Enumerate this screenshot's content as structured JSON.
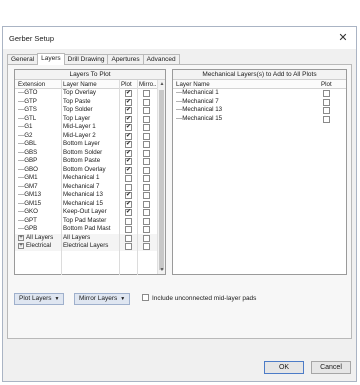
{
  "window": {
    "title": "Gerber Setup",
    "close_glyph": "✕"
  },
  "tabs": [
    "General",
    "Layers",
    "Drill Drawing",
    "Apertures",
    "Advanced"
  ],
  "left_panel": {
    "title": "Layers To Plot",
    "columns": [
      "Extension",
      "Layer Name",
      "Plot",
      "Mirro..."
    ],
    "rows": [
      {
        "ext": "GTO",
        "name": "Top Overlay",
        "plot": true,
        "mirror": false
      },
      {
        "ext": "GTP",
        "name": "Top Paste",
        "plot": true,
        "mirror": false
      },
      {
        "ext": "GTS",
        "name": "Top Solder",
        "plot": true,
        "mirror": false
      },
      {
        "ext": "GTL",
        "name": "Top Layer",
        "plot": true,
        "mirror": false
      },
      {
        "ext": "G1",
        "name": "Mid-Layer 1",
        "plot": true,
        "mirror": false
      },
      {
        "ext": "G2",
        "name": "Mid-Layer 2",
        "plot": true,
        "mirror": false
      },
      {
        "ext": "GBL",
        "name": "Bottom Layer",
        "plot": true,
        "mirror": false
      },
      {
        "ext": "GBS",
        "name": "Bottom Solder",
        "plot": true,
        "mirror": false
      },
      {
        "ext": "GBP",
        "name": "Bottom Paste",
        "plot": true,
        "mirror": false
      },
      {
        "ext": "GBO",
        "name": "Bottom Overlay",
        "plot": true,
        "mirror": false
      },
      {
        "ext": "GM1",
        "name": "Mechanical 1",
        "plot": false,
        "mirror": false
      },
      {
        "ext": "GM7",
        "name": "Mechanical 7",
        "plot": false,
        "mirror": false
      },
      {
        "ext": "GM13",
        "name": "Mechanical 13",
        "plot": true,
        "mirror": false
      },
      {
        "ext": "GM15",
        "name": "Mechanical 15",
        "plot": true,
        "mirror": false
      },
      {
        "ext": "GKO",
        "name": "Keep-Out Layer",
        "plot": true,
        "mirror": false
      },
      {
        "ext": "GPT",
        "name": "Top Pad Master",
        "plot": false,
        "mirror": false
      },
      {
        "ext": "GPB",
        "name": "Bottom Pad Mast",
        "plot": false,
        "mirror": false
      }
    ],
    "group_rows": [
      {
        "ext": "All Layers",
        "name": "All Layers",
        "plot": false,
        "mirror": false
      },
      {
        "ext": "Electrical",
        "name": "Electrical Layers",
        "plot": false,
        "mirror": false
      }
    ]
  },
  "right_panel": {
    "title": "Mechanical Layers(s) to Add to All Plots",
    "columns": [
      "Layer Name",
      "Plot"
    ],
    "rows": [
      {
        "name": "Mechanical 1",
        "plot": false
      },
      {
        "name": "Mechanical 7",
        "plot": false
      },
      {
        "name": "Mechanical 13",
        "plot": false
      },
      {
        "name": "Mechanical 15",
        "plot": false
      }
    ]
  },
  "bottom": {
    "plot_layers_label": "Plot Layers",
    "mirror_layers_label": "Mirror Layers",
    "include_unconnected_label": "Include unconnected mid-layer pads",
    "include_unconnected_checked": false
  },
  "footer": {
    "ok_label": "OK",
    "cancel_label": "Cancel"
  },
  "colors": {
    "dropdown_bg": "#dfe6f1",
    "default_button_border": "#4d7cc7"
  }
}
